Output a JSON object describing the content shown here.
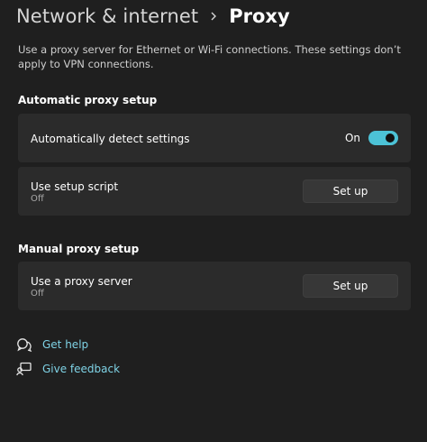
{
  "breadcrumb": {
    "parent": "Network & internet",
    "separator_icon": "chevron-right-icon",
    "current": "Proxy"
  },
  "description": "Use a proxy server for Ethernet or Wi-Fi connections. These settings don’t apply to VPN connections.",
  "automatic": {
    "title": "Automatic proxy setup",
    "detect": {
      "label": "Automatically detect settings",
      "state_text": "On",
      "enabled": true
    },
    "script": {
      "label": "Use setup script",
      "sub": "Off",
      "button": "Set up"
    }
  },
  "manual": {
    "title": "Manual proxy setup",
    "proxy": {
      "label": "Use a proxy server",
      "sub": "Off",
      "button": "Set up"
    }
  },
  "links": {
    "help": {
      "label": "Get help",
      "icon": "help-chat-icon"
    },
    "feedback": {
      "label": "Give feedback",
      "icon": "feedback-icon"
    }
  },
  "colors": {
    "background": "#1f1f1f",
    "card": "#2b2b2b",
    "accent": "#4cc2d6",
    "link": "#7fd3e6"
  }
}
